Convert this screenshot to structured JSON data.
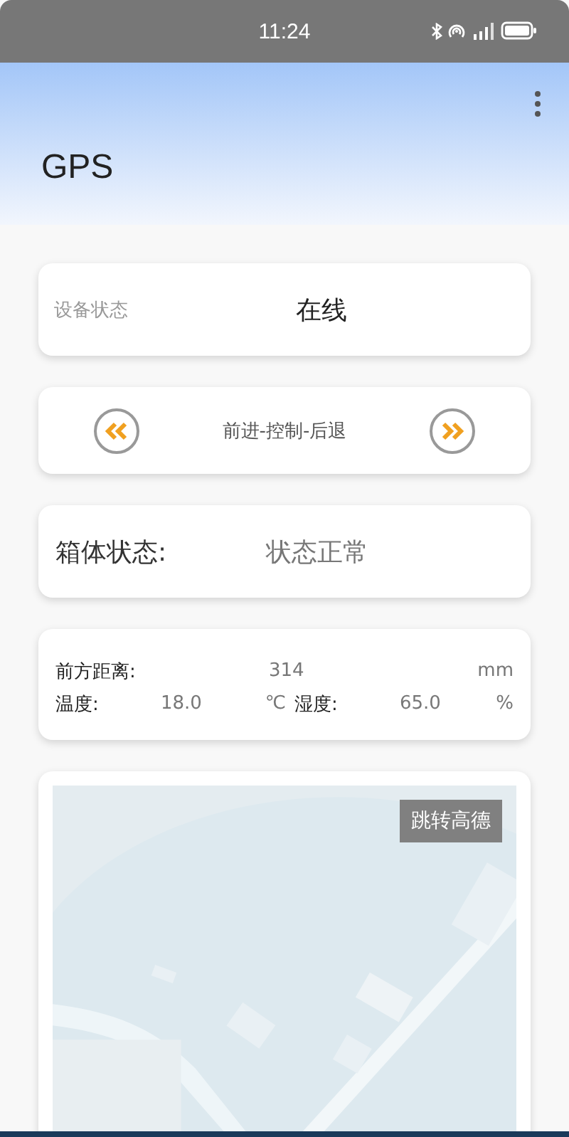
{
  "status_bar": {
    "time": "11:24"
  },
  "app_bar": {
    "title": "GPS"
  },
  "device_status": {
    "label": "设备状态",
    "value": "在线"
  },
  "control": {
    "label": "前进-控制-后退",
    "buttons": [
      {
        "kind": "back"
      },
      {
        "kind": "forward"
      }
    ]
  },
  "box_status": {
    "label": "箱体状态:",
    "value": "状态正常"
  },
  "readings": {
    "distance": {
      "label": "前方距离:",
      "value": "314",
      "unit": "mm"
    },
    "temperature": {
      "label": "温度:",
      "value": "18.0",
      "unit": "℃"
    },
    "humidity": {
      "label": "湿度:",
      "value": "65.0",
      "unit": "%"
    }
  },
  "map": {
    "kind": "picture",
    "button": "跳转高德"
  }
}
